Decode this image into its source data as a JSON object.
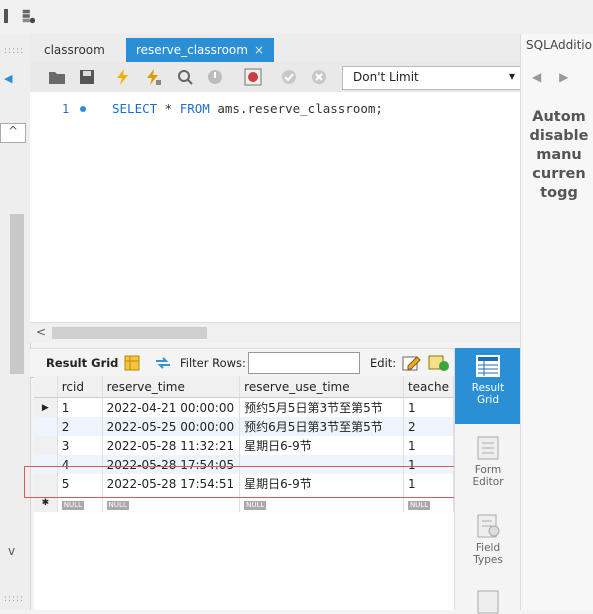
{
  "tabs": [
    {
      "label": "classroom",
      "active": false
    },
    {
      "label": "reserve_classroom",
      "active": true
    }
  ],
  "tab_close_glyph": "×",
  "toolbar": {
    "limit_label": "Don't Limit"
  },
  "editor": {
    "line_number": "1",
    "sql_keyword_select": "SELECT",
    "sql_star": " * ",
    "sql_keyword_from": "FROM",
    "sql_rest": " ams.reserve_classroom;"
  },
  "result_bar": {
    "result_grid_label": "Result Grid",
    "filter_rows_label": "Filter Rows:",
    "edit_label": "Edit:"
  },
  "grid": {
    "columns": [
      "rcid",
      "reserve_time",
      "reserve_use_time",
      "teache"
    ],
    "rows": [
      {
        "marker": "▶",
        "rcid": "1",
        "reserve_time": "2022-04-21 00:00:00",
        "reserve_use_time": "预约5月5日第3节至第5节",
        "teacher": "1"
      },
      {
        "marker": "",
        "rcid": "2",
        "reserve_time": "2022-05-25 00:00:00",
        "reserve_use_time": "预约6月5日第3节至第5节",
        "teacher": "2"
      },
      {
        "marker": "",
        "rcid": "3",
        "reserve_time": "2022-05-28 11:32:21",
        "reserve_use_time": "星期日6-9节",
        "teacher": "1"
      },
      {
        "marker": "",
        "rcid": "4",
        "reserve_time": "2022-05-28 17:54:05",
        "reserve_use_time": "",
        "teacher": "1"
      },
      {
        "marker": "",
        "rcid": "5",
        "reserve_time": "2022-05-28 17:54:51",
        "reserve_use_time": "星期日6-9节",
        "teacher": "1"
      }
    ],
    "new_row_marker": "✱",
    "null_label": "NULL"
  },
  "side_tools": [
    {
      "label": "Result Grid",
      "active": true
    },
    {
      "label": "Form Editor",
      "active": false
    },
    {
      "label": "Field Types",
      "active": false
    }
  ],
  "sql_additions": {
    "title": "SQLAdditions",
    "arrow_left": "◀",
    "arrow_right": "▶",
    "text_lines": [
      "Autom",
      "disable",
      "manu",
      "curren",
      "togg"
    ]
  },
  "colors": {
    "accent": "#2b8fd6",
    "selection_box": "#d85a5a"
  }
}
